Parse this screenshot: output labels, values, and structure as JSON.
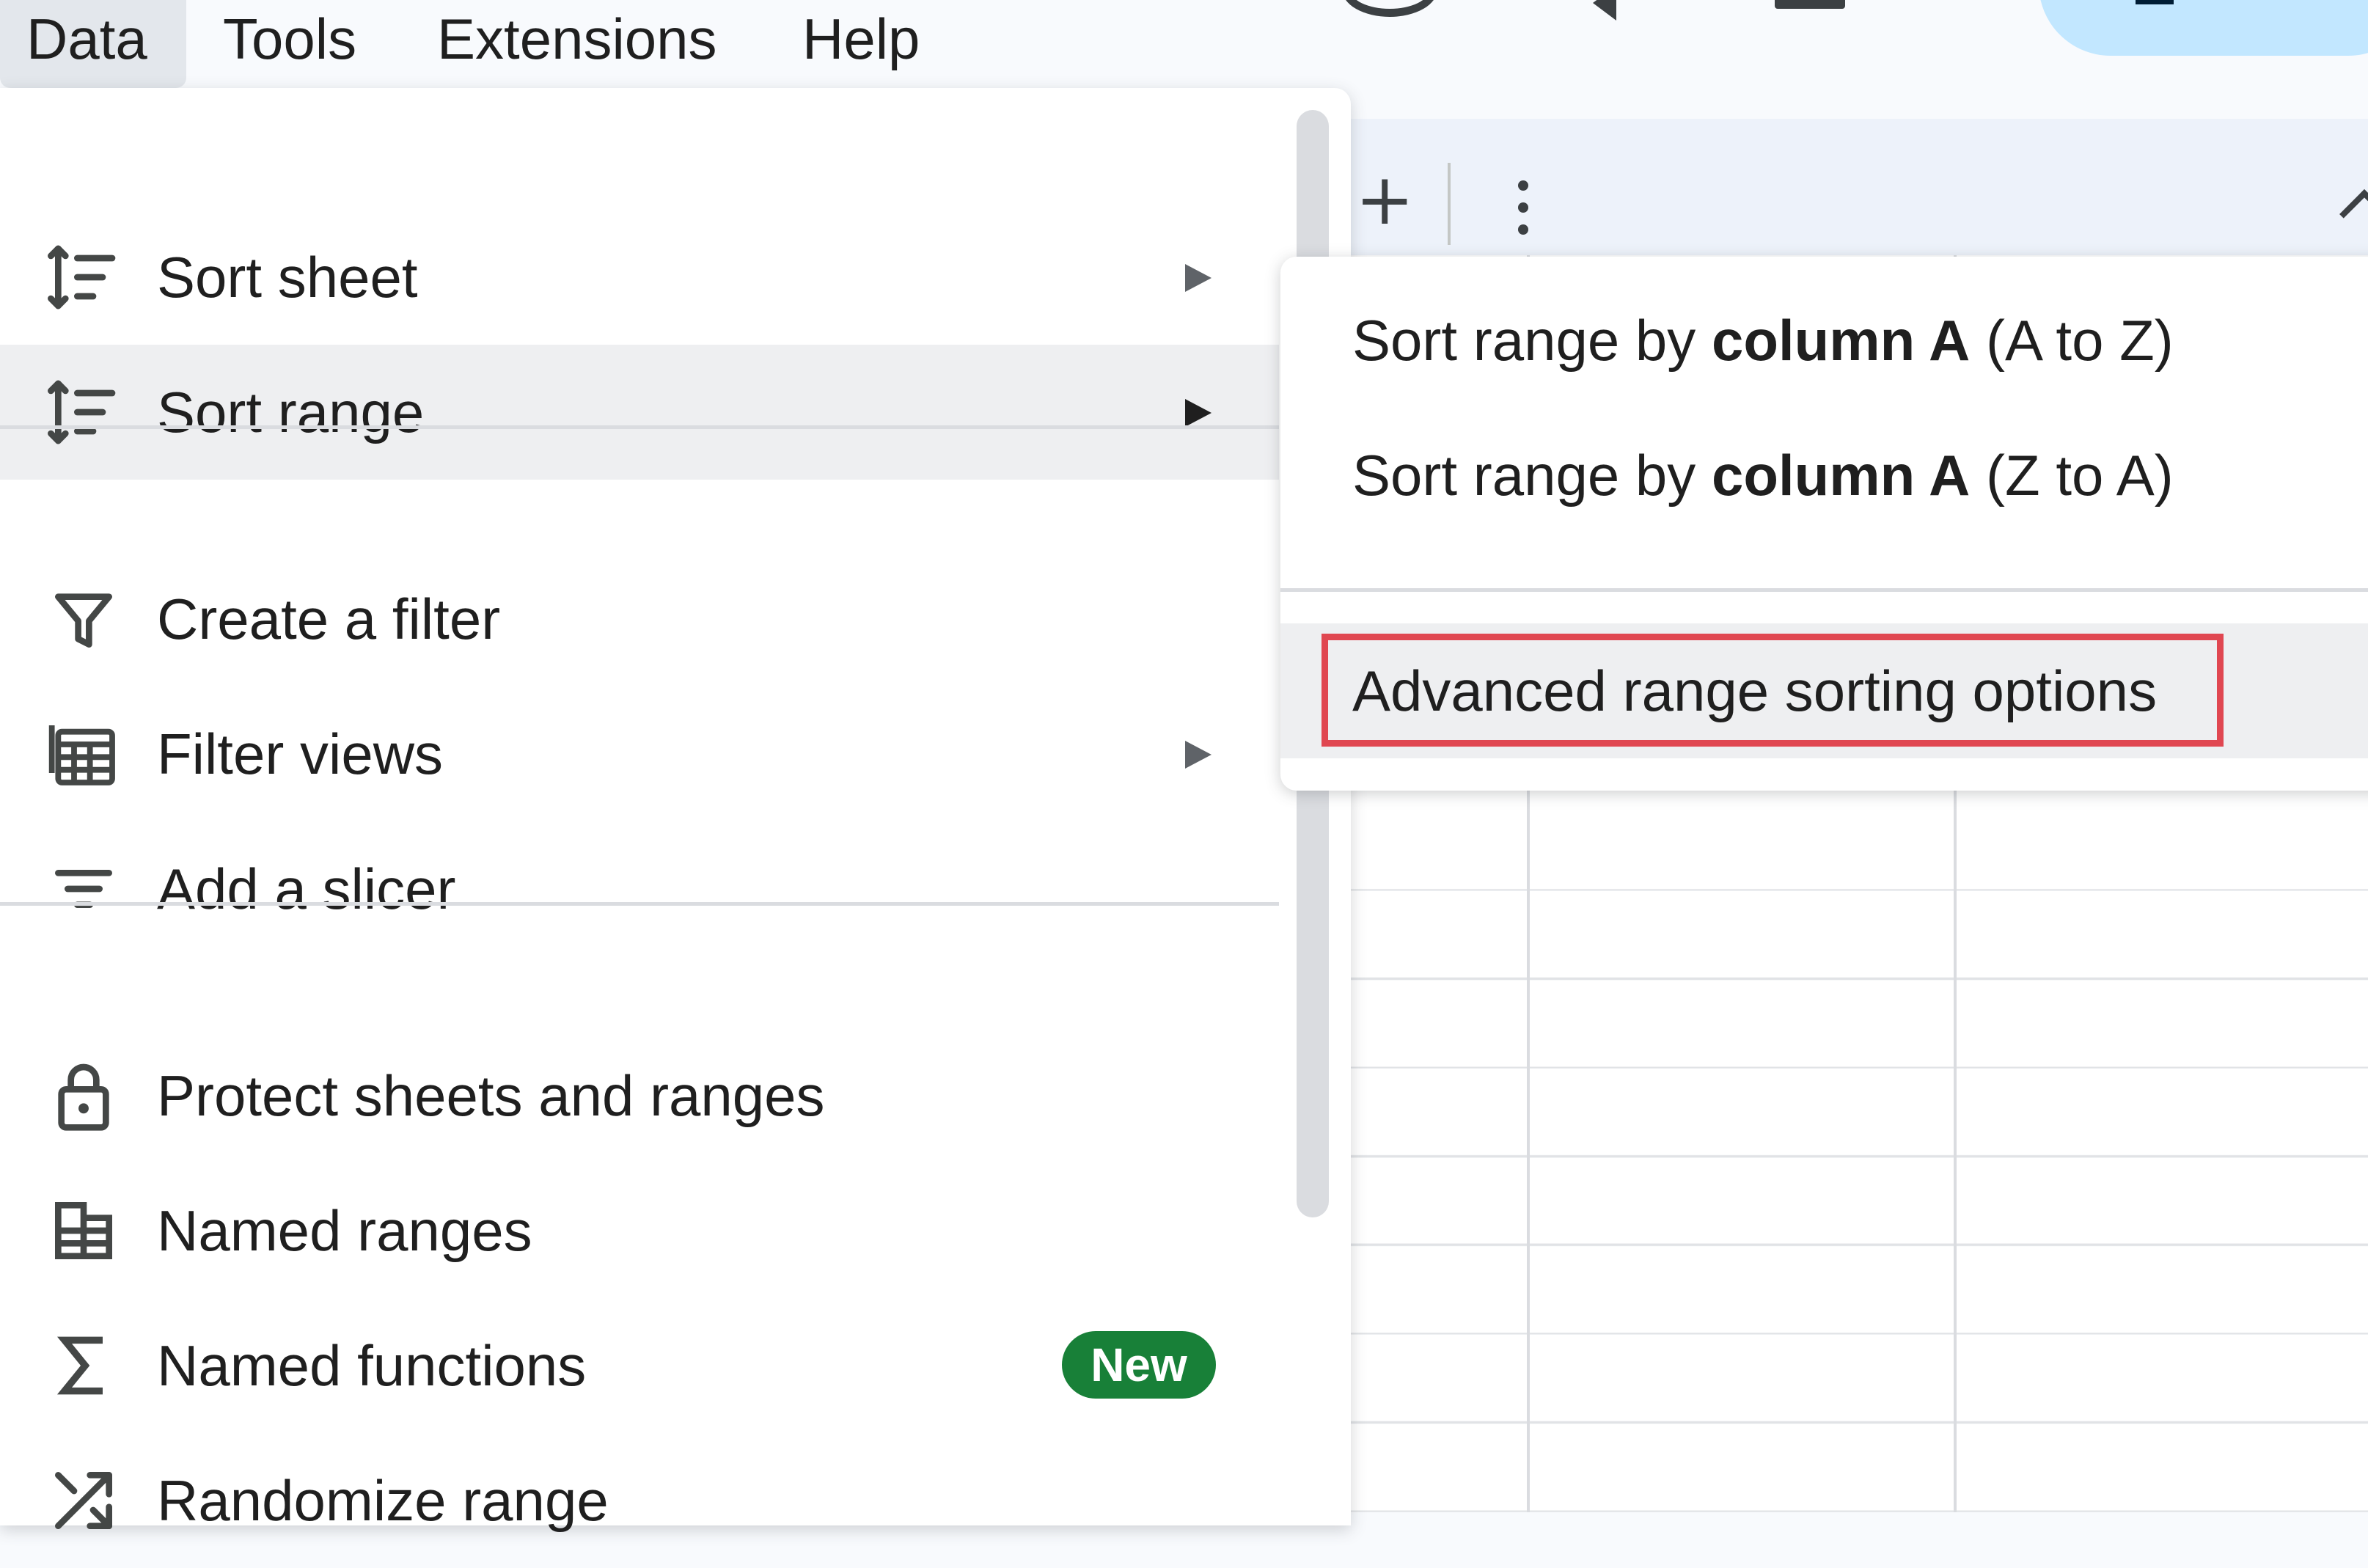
{
  "menubar": {
    "items": [
      {
        "label": "Data"
      },
      {
        "label": "Tools"
      },
      {
        "label": "Extensions"
      },
      {
        "label": "Help"
      }
    ]
  },
  "toolbar": {
    "add_icon": "plus-icon",
    "more_icon": "more-vert-icon"
  },
  "data_menu": {
    "items": [
      {
        "label": "Sort sheet",
        "icon": "sort-icon",
        "has_submenu": true
      },
      {
        "label": "Sort range",
        "icon": "sort-icon",
        "has_submenu": true,
        "highlighted": true
      },
      {
        "label": "Create a filter",
        "icon": "filter-icon"
      },
      {
        "label": "Filter views",
        "icon": "filter-views-icon",
        "has_submenu": true
      },
      {
        "label": "Add a slicer",
        "icon": "slicer-icon"
      },
      {
        "label": "Protect sheets and ranges",
        "icon": "lock-icon"
      },
      {
        "label": "Named ranges",
        "icon": "named-ranges-icon"
      },
      {
        "label": "Named functions",
        "icon": "sigma-icon",
        "badge": "New"
      },
      {
        "label": "Randomize range",
        "icon": "shuffle-icon"
      }
    ]
  },
  "sort_range_submenu": {
    "items": [
      {
        "prefix": "Sort range by ",
        "bold": "column A",
        "suffix": " (A to Z)"
      },
      {
        "prefix": "Sort range by ",
        "bold": "column A",
        "suffix": " (Z to A)"
      },
      {
        "label": "Advanced range sorting options",
        "highlighted": true
      }
    ]
  },
  "colors": {
    "highlight_box": "#e04751",
    "new_badge": "#188038",
    "menu_hover": "#eeeff1"
  }
}
